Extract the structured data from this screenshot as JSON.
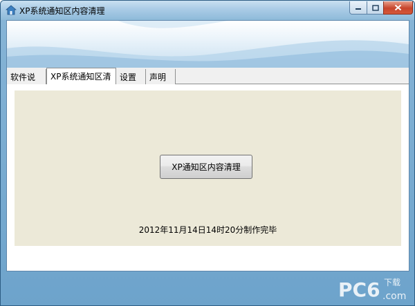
{
  "window": {
    "title": "XP系统通知区内容清理"
  },
  "tabs": [
    {
      "label": "软件说明",
      "active": false
    },
    {
      "label": "XP系统通知区清理",
      "active": true
    },
    {
      "label": "设置",
      "active": false
    },
    {
      "label": "声明",
      "active": false
    }
  ],
  "panel": {
    "clean_button_label": "XP通知区内容清理",
    "made_text": "2012年11月14日14时20分制作完毕"
  },
  "watermark": {
    "text": "PC6",
    "sub": "下载",
    "domain": ".com"
  },
  "colors": {
    "frame": "#6da3cb",
    "close_button": "#c7452c",
    "group_background": "#ece9d8"
  }
}
